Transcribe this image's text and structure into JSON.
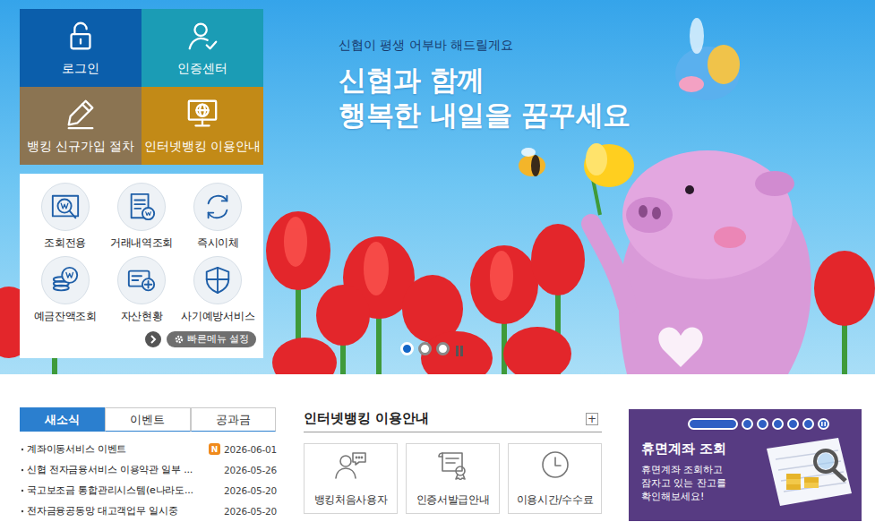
{
  "banner": {
    "subtitle": "신협이 평생 어부바 해드릴게요",
    "title_lines": [
      "신협과 함께",
      "행복한 내일을 꿈꾸세요"
    ],
    "slides": [
      {
        "selected": true
      },
      {
        "selected": false
      },
      {
        "selected": false
      }
    ]
  },
  "tiles": [
    {
      "label": "로그인",
      "color": "#0b5eab"
    },
    {
      "label": "인증센터",
      "color": "#1b9cb5"
    },
    {
      "label": "뱅킹 신규가입 절차",
      "color": "#8b7452"
    },
    {
      "label": "인터넷뱅킹 이용안내",
      "color": "#c28a17"
    }
  ],
  "quick_menu": {
    "items": [
      "조회전용",
      "거래내역조회",
      "즉시이체",
      "예금잔액조회",
      "자산현황",
      "사기예방서비스"
    ],
    "settings": "빠른메뉴 설정"
  },
  "news": {
    "tabs": [
      {
        "label": "새소식",
        "selected": true
      },
      {
        "label": "이벤트",
        "selected": false
      },
      {
        "label": "공과금",
        "selected": false
      }
    ],
    "items": [
      {
        "title": "계좌이동서비스 이벤트",
        "badge": "N",
        "date": "2026-06-01"
      },
      {
        "title": "신협 전자금융서비스 이용약관 일부 ...",
        "date": "2026-05-26"
      },
      {
        "title": "국고보조금 통합관리시스템(e나라도...",
        "date": "2026-05-20"
      },
      {
        "title": "전자금융공동망 대고객업무 일시중",
        "date": "2026-05-20"
      }
    ]
  },
  "guide": {
    "title": "인터넷뱅킹 이용안내",
    "more": "+",
    "cards": [
      "뱅킹처음사용자",
      "인증서발급안내",
      "이용시간/수수료"
    ]
  },
  "dormant": {
    "title": "휴면계좌 조회",
    "description_lines": [
      "휴면계좌 조회하고",
      "잠자고 있는 잔고를",
      "확인해보세요!"
    ],
    "slides": [
      {
        "selected": true
      },
      {
        "selected": false
      },
      {
        "selected": false
      },
      {
        "selected": false
      },
      {
        "selected": false
      },
      {
        "selected": false
      }
    ]
  }
}
